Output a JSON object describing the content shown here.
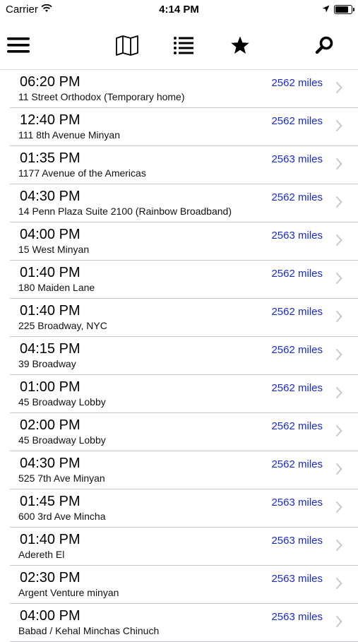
{
  "status": {
    "carrier": "Carrier",
    "time": "4:14 PM",
    "battery_level": 0.85
  },
  "toolbar": {
    "icons": [
      "hamburger-menu-icon",
      "map-icon",
      "list-icon",
      "star-icon",
      "search-icon"
    ]
  },
  "colors": {
    "distance": "#1a2bd1",
    "separator": "#c8c7cc",
    "chevron": "#c7c7cc"
  },
  "rows": [
    {
      "time": "06:20 PM",
      "name": "11 Street Orthodox (Temporary home)",
      "distance": "2562 miles"
    },
    {
      "time": "12:40 PM",
      "name": "111 8th Avenue Minyan",
      "distance": "2562 miles"
    },
    {
      "time": "01:35 PM",
      "name": "1177 Avenue of the Americas",
      "distance": "2563 miles"
    },
    {
      "time": "04:30 PM",
      "name": "14 Penn Plaza Suite 2100 (Rainbow Broadband)",
      "distance": "2562 miles"
    },
    {
      "time": "04:00 PM",
      "name": "15 West Minyan",
      "distance": "2563 miles"
    },
    {
      "time": "01:40 PM",
      "name": "180 Maiden Lane",
      "distance": "2562 miles"
    },
    {
      "time": "01:40 PM",
      "name": "225 Broadway, NYC",
      "distance": "2562 miles"
    },
    {
      "time": "04:15 PM",
      "name": "39 Broadway",
      "distance": "2562 miles"
    },
    {
      "time": "01:00 PM",
      "name": "45 Broadway Lobby",
      "distance": "2562 miles"
    },
    {
      "time": "02:00 PM",
      "name": "45 Broadway Lobby",
      "distance": "2562 miles"
    },
    {
      "time": "04:30 PM",
      "name": "525 7th Ave Minyan",
      "distance": "2562 miles"
    },
    {
      "time": "01:45 PM",
      "name": "600 3rd Ave Mincha",
      "distance": "2563 miles"
    },
    {
      "time": "01:40 PM",
      "name": "Adereth El",
      "distance": "2563 miles"
    },
    {
      "time": "02:30 PM",
      "name": "Argent Venture minyan",
      "distance": "2563 miles"
    },
    {
      "time": "04:00 PM",
      "name": "Babad / Kehal Minchas Chinuch",
      "distance": "2563 miles"
    }
  ]
}
